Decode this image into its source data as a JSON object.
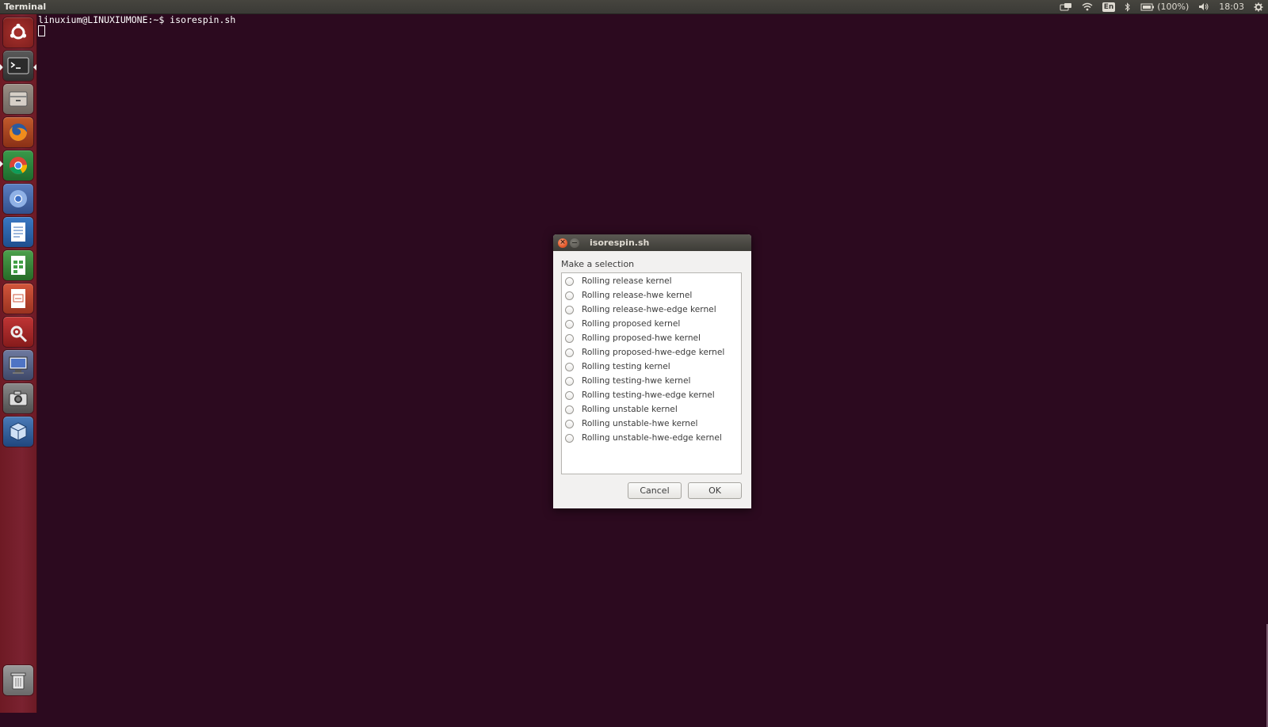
{
  "panel": {
    "app_title": "Terminal",
    "battery": "(100%)",
    "keyboard": "En",
    "clock": "18:03"
  },
  "launcher": {
    "items": [
      {
        "name": "dash-icon"
      },
      {
        "name": "terminal-icon"
      },
      {
        "name": "files-icon"
      },
      {
        "name": "firefox-icon"
      },
      {
        "name": "chrome-icon"
      },
      {
        "name": "chromium-icon"
      },
      {
        "name": "writer-icon"
      },
      {
        "name": "calc-icon"
      },
      {
        "name": "impress-icon"
      },
      {
        "name": "settings-icon"
      },
      {
        "name": "remote-desktop-icon"
      },
      {
        "name": "camera-icon"
      },
      {
        "name": "virtualbox-icon"
      },
      {
        "name": "trash-icon"
      }
    ]
  },
  "terminal": {
    "prompt_line": "linuxium@LINUXIUMONE:~$ isorespin.sh"
  },
  "dialog": {
    "title": "isorespin.sh",
    "prompt": "Make a selection",
    "options": [
      "Rolling release kernel",
      "Rolling release-hwe kernel",
      "Rolling release-hwe-edge kernel",
      "Rolling proposed kernel",
      "Rolling proposed-hwe kernel",
      "Rolling proposed-hwe-edge kernel",
      "Rolling testing kernel",
      "Rolling testing-hwe kernel",
      "Rolling testing-hwe-edge kernel",
      "Rolling unstable kernel",
      "Rolling unstable-hwe kernel",
      "Rolling unstable-hwe-edge kernel"
    ],
    "cancel_label": "Cancel",
    "ok_label": "OK"
  }
}
